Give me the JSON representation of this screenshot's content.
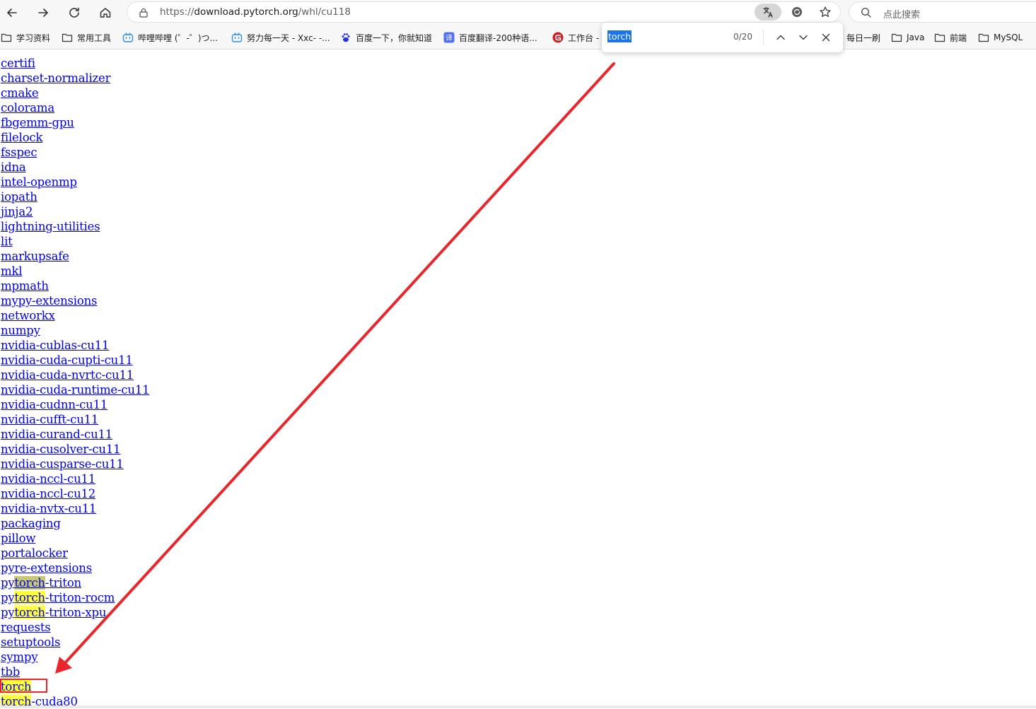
{
  "address_bar": {
    "url_prefix": "https://",
    "url_host": "download.pytorch.org",
    "url_path": "/whl/cu118"
  },
  "search": {
    "placeholder": "点此搜索"
  },
  "favorites": [
    {
      "label": "学习资料",
      "icon": "folder-icon"
    },
    {
      "label": "常用工具",
      "icon": "folder-icon"
    },
    {
      "label": "哔哩哔哩 (゜-゜)つ...",
      "icon": "bilibili-icon"
    },
    {
      "label": "努力每一天 - Xxc- -...",
      "icon": "bilibili-icon"
    },
    {
      "label": "百度一下，你就知道",
      "icon": "baidu-icon"
    },
    {
      "label": "百度翻译-200种语...",
      "icon": "translate-icon"
    },
    {
      "label": "工作台 -",
      "icon": "gitee-icon"
    },
    {
      "label": "每日一刷",
      "icon": "folder-icon"
    },
    {
      "label": "Java",
      "icon": "folder-icon"
    },
    {
      "label": "前端",
      "icon": "folder-icon"
    },
    {
      "label": "MySQL",
      "icon": "folder-icon"
    }
  ],
  "find_bar": {
    "query": "torch",
    "count": "0/20"
  },
  "packages": [
    {
      "pre": "",
      "hl": "",
      "rest": "certifi"
    },
    {
      "pre": "",
      "hl": "",
      "rest": "charset-normalizer"
    },
    {
      "pre": "",
      "hl": "",
      "rest": "cmake"
    },
    {
      "pre": "",
      "hl": "",
      "rest": "colorama"
    },
    {
      "pre": "",
      "hl": "",
      "rest": "fbgemm-gpu"
    },
    {
      "pre": "",
      "hl": "",
      "rest": "filelock"
    },
    {
      "pre": "",
      "hl": "",
      "rest": "fsspec"
    },
    {
      "pre": "",
      "hl": "",
      "rest": "idna"
    },
    {
      "pre": "",
      "hl": "",
      "rest": "intel-openmp"
    },
    {
      "pre": "",
      "hl": "",
      "rest": "iopath"
    },
    {
      "pre": "",
      "hl": "",
      "rest": "jinja2"
    },
    {
      "pre": "",
      "hl": "",
      "rest": "lightning-utilities"
    },
    {
      "pre": "",
      "hl": "",
      "rest": "lit"
    },
    {
      "pre": "",
      "hl": "",
      "rest": "markupsafe"
    },
    {
      "pre": "",
      "hl": "",
      "rest": "mkl"
    },
    {
      "pre": "",
      "hl": "",
      "rest": "mpmath"
    },
    {
      "pre": "",
      "hl": "",
      "rest": "mypy-extensions"
    },
    {
      "pre": "",
      "hl": "",
      "rest": "networkx"
    },
    {
      "pre": "",
      "hl": "",
      "rest": "numpy"
    },
    {
      "pre": "",
      "hl": "",
      "rest": "nvidia-cublas-cu11"
    },
    {
      "pre": "",
      "hl": "",
      "rest": "nvidia-cuda-cupti-cu11"
    },
    {
      "pre": "",
      "hl": "",
      "rest": "nvidia-cuda-nvrtc-cu11"
    },
    {
      "pre": "",
      "hl": "",
      "rest": "nvidia-cuda-runtime-cu11"
    },
    {
      "pre": "",
      "hl": "",
      "rest": "nvidia-cudnn-cu11"
    },
    {
      "pre": "",
      "hl": "",
      "rest": "nvidia-cufft-cu11"
    },
    {
      "pre": "",
      "hl": "",
      "rest": "nvidia-curand-cu11"
    },
    {
      "pre": "",
      "hl": "",
      "rest": "nvidia-cusolver-cu11"
    },
    {
      "pre": "",
      "hl": "",
      "rest": "nvidia-cusparse-cu11"
    },
    {
      "pre": "",
      "hl": "",
      "rest": "nvidia-nccl-cu11"
    },
    {
      "pre": "",
      "hl": "",
      "rest": "nvidia-nccl-cu12"
    },
    {
      "pre": "",
      "hl": "",
      "rest": "nvidia-nvtx-cu11"
    },
    {
      "pre": "",
      "hl": "",
      "rest": "packaging"
    },
    {
      "pre": "",
      "hl": "",
      "rest": "pillow"
    },
    {
      "pre": "",
      "hl": "",
      "rest": "portalocker"
    },
    {
      "pre": "",
      "hl": "",
      "rest": "pyre-extensions"
    },
    {
      "pre": "py",
      "hl": "torch",
      "rest": "-triton",
      "current": true
    },
    {
      "pre": "py",
      "hl": "torch",
      "rest": "-triton-rocm"
    },
    {
      "pre": "py",
      "hl": "torch",
      "rest": "-triton-xpu"
    },
    {
      "pre": "",
      "hl": "",
      "rest": "requests"
    },
    {
      "pre": "",
      "hl": "",
      "rest": "setuptools"
    },
    {
      "pre": "",
      "hl": "",
      "rest": "sympy"
    },
    {
      "pre": "",
      "hl": "",
      "rest": "tbb"
    },
    {
      "pre": "",
      "hl": "torch",
      "rest": ""
    },
    {
      "pre": "",
      "hl": "torch",
      "rest": "-cuda80"
    }
  ],
  "colors": {
    "link": "#0000ee",
    "highlight": "#ffff38",
    "annotation": "#e8262c"
  }
}
